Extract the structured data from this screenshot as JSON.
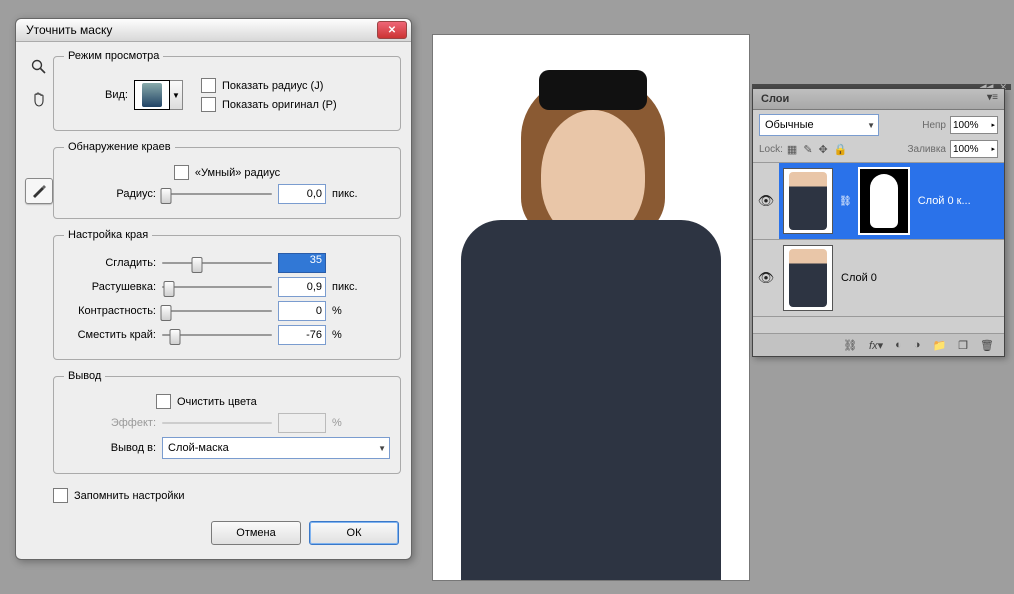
{
  "dialog": {
    "title": "Уточнить маску",
    "view_mode": {
      "legend": "Режим просмотра",
      "view_label": "Вид:",
      "show_radius": "Показать радиус (J)",
      "show_original": "Показать оригинал (P)"
    },
    "edge_detect": {
      "legend": "Обнаружение краев",
      "smart_radius": "«Умный» радиус",
      "radius_label": "Радиус:",
      "radius_value": "0,0",
      "radius_unit": "пикс."
    },
    "edge_adjust": {
      "legend": "Настройка края",
      "smooth_label": "Сгладить:",
      "smooth_value": "35",
      "feather_label": "Растушевка:",
      "feather_value": "0,9",
      "feather_unit": "пикс.",
      "contrast_label": "Контрастность:",
      "contrast_value": "0",
      "contrast_unit": "%",
      "shift_label": "Сместить край:",
      "shift_value": "-76",
      "shift_unit": "%"
    },
    "output": {
      "legend": "Вывод",
      "decontaminate": "Очистить цвета",
      "amount_label": "Эффект:",
      "amount_unit": "%",
      "output_label": "Вывод в:",
      "output_value": "Слой-маска"
    },
    "remember": "Запомнить настройки",
    "cancel": "Отмена",
    "ok": "ОК"
  },
  "panel": {
    "title": "Слои",
    "blend": "Обычные",
    "opacity_label": "Непр",
    "opacity": "100%",
    "lock_label": "Lock:",
    "fill_label": "Заливка",
    "fill": "100%",
    "layer0_copy": "Слой 0 к...",
    "layer0": "Слой 0"
  }
}
